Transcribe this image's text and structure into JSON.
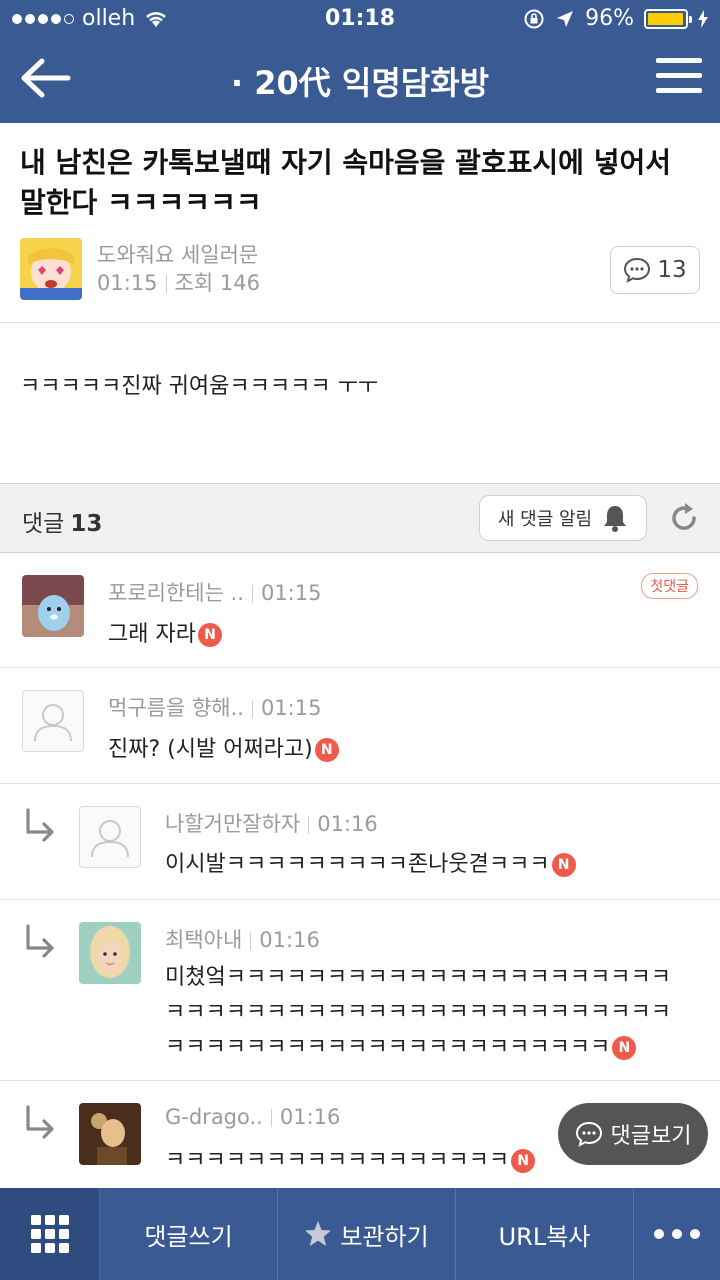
{
  "status_bar": {
    "carrier": "olleh",
    "time": "01:18",
    "battery_percent": "96%"
  },
  "nav": {
    "title": "· 20代 익명담화방"
  },
  "post": {
    "title": "내 남친은 카톡보낼때 자기 속마음을 괄호표시에 넣어서 말한다 ㅋㅋㅋㅋㅋㅋ",
    "author": "도와줘요 세일러문",
    "time": "01:15",
    "views_label": "조회 146",
    "comment_count": "13",
    "body": "ㅋㅋㅋㅋㅋ진짜 귀여움ㅋㅋㅋㅋㅋ ㅜㅜ"
  },
  "comments_header": {
    "label": "댓글",
    "count": "13",
    "notify_label": "새 댓글 알림"
  },
  "comments": [
    {
      "name": "포로리한테는 ..",
      "time": "01:15",
      "text": "그래 자라",
      "badge": "N",
      "first_badge": "첫댓글"
    },
    {
      "name": "먹구름을 향해..",
      "time": "01:15",
      "text": "진짜? (시발 어쩌라고)",
      "badge": "N"
    },
    {
      "name": "나할거만잘하자",
      "time": "01:16",
      "text": "이시발ㅋㅋㅋㅋㅋㅋㅋㅋㅋ존나웃겯ㅋㅋㅋ",
      "badge": "N"
    },
    {
      "name": "최택아내",
      "time": "01:16",
      "text": "미쳤엌ㅋㅋㅋㅋㅋㅋㅋㅋㅋㅋㅋㅋㅋㅋㅋㅋㅋㅋㅋㅋㅋㅋㅋㅋㅋㅋㅋㅋㅋㅋㅋㅋㅋㅋㅋㅋㅋㅋㅋㅋㅋㅋㅋㅋㅋㅋㅋㅋㅋㅋㅋㅋㅋㅋㅋㅋㅋㅋㅋㅋㅋㅋㅋㅋㅋㅋㅋㅋㅋ",
      "badge": "N"
    },
    {
      "name": "G-drago..",
      "time": "01:16",
      "text": "ㅋㅋㅋㅋㅋㅋㅋㅋㅋㅋㅋㅋㅋㅋㅋㅋㅋ",
      "badge": "N"
    }
  ],
  "float_button": {
    "label": "댓글보기"
  },
  "bottom_bar": {
    "write_comment": "댓글쓰기",
    "save": "보관하기",
    "copy_url": "URL복사"
  },
  "colors": {
    "header_bg": "#3a5a93",
    "badge_red": "#ef5b4b",
    "battery": "#ffcc00"
  }
}
